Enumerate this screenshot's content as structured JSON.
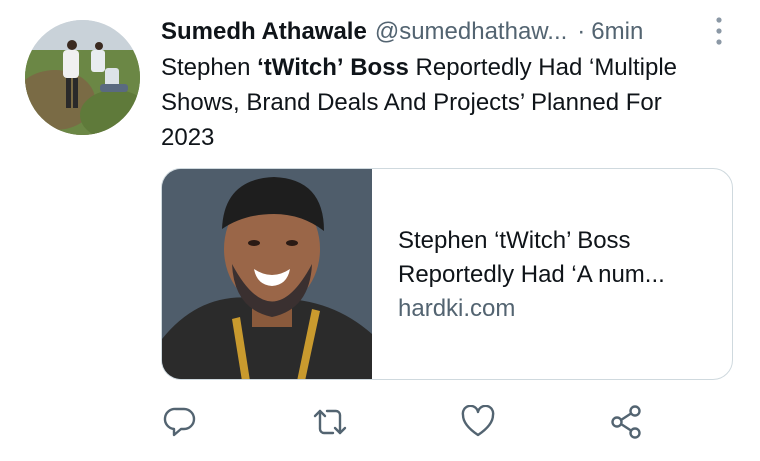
{
  "tweet": {
    "author_name": "Sumedh Athawale",
    "author_handle": "@sumedhathaw...",
    "separator": "·",
    "time": "6min",
    "text_parts": [
      "Stephen ",
      "‘tWitch’",
      " ",
      "Boss",
      " Reportedly Had ‘Multiple Shows, Brand Deals And Projects’ Planned For 2023"
    ]
  },
  "card": {
    "title": "Stephen ‘tWitch’ Boss\nReportedly Had ‘A num...",
    "domain": "hardki.com"
  },
  "icons": {
    "more": "more-vertical-icon",
    "reply": "reply-icon",
    "retweet": "retweet-icon",
    "like": "like-icon",
    "share": "share-icon"
  },
  "colors": {
    "text": "#0f1419",
    "secondary": "#536471",
    "border": "#cfd9de"
  }
}
